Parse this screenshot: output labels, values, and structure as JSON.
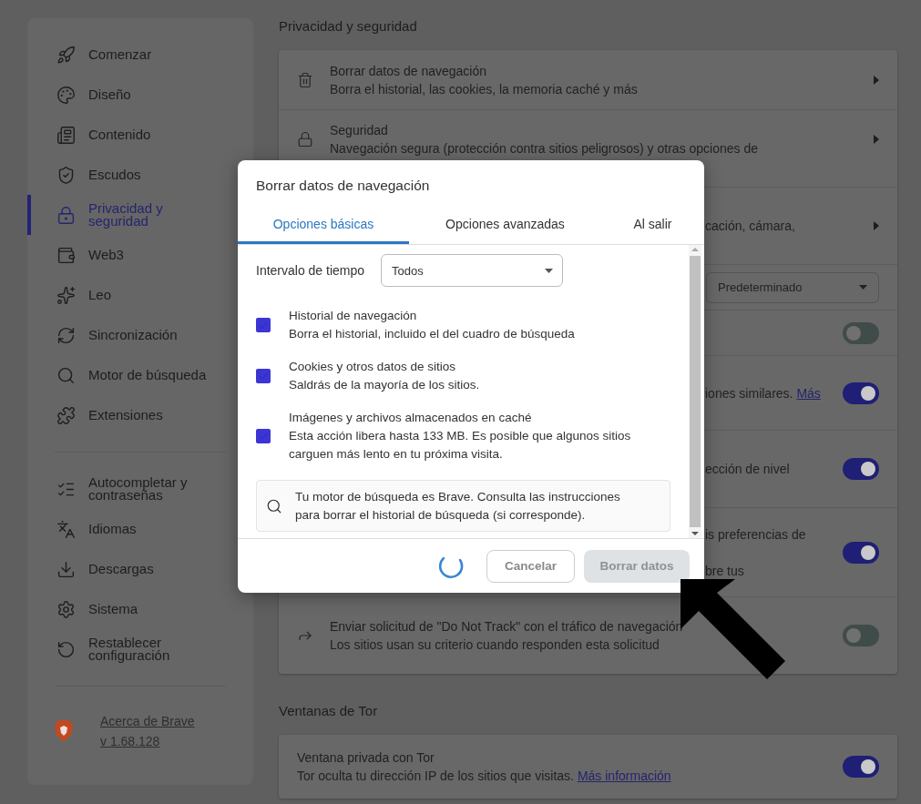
{
  "sidebar": {
    "groups": [
      {
        "items": [
          {
            "label": "Comenzar",
            "selected": false
          },
          {
            "label": "Diseño",
            "selected": false
          },
          {
            "label": "Contenido",
            "selected": false
          },
          {
            "label": "Escudos",
            "selected": false
          },
          {
            "label": "Privacidad y seguridad",
            "selected": true
          },
          {
            "label": "Web3",
            "selected": false
          },
          {
            "label": "Leo",
            "selected": false
          },
          {
            "label": "Sincronización",
            "selected": false
          },
          {
            "label": "Motor de búsqueda",
            "selected": false
          },
          {
            "label": "Extensiones",
            "selected": false
          }
        ]
      },
      {
        "items": [
          {
            "label": "Autocompletar y contraseñas",
            "selected": false
          },
          {
            "label": "Idiomas",
            "selected": false
          },
          {
            "label": "Descargas",
            "selected": false
          },
          {
            "label": "Sistema",
            "selected": false
          },
          {
            "label": "Restablecer configuración",
            "selected": false
          }
        ]
      }
    ],
    "about": {
      "link": "Acerca de Brave",
      "version": "v 1.68.128"
    }
  },
  "sections": [
    {
      "title": "Privacidad y seguridad",
      "rows": [
        {
          "kind": "arrow",
          "title": "Borrar datos de navegación",
          "description": "Borra el historial, las cookies, la memoria caché y más"
        },
        {
          "kind": "arrow",
          "title": "Seguridad",
          "description": "Navegación segura (protección contra sitios peligrosos) y otras opciones de"
        },
        {
          "kind": "arrow",
          "lines": [
            "cación, cámara,"
          ]
        },
        {
          "kind": "select",
          "value": "Predeterminado"
        },
        {
          "kind": "toggle",
          "on": false
        },
        {
          "kind": "toggle",
          "lines": [
            "iones similares."
          ],
          "link": "Más",
          "on": true
        },
        {
          "kind": "toggle",
          "lines": [
            "ección de nivel"
          ],
          "on": true
        },
        {
          "kind": "toggle",
          "lines": [
            "is preferencias de",
            "bre tus"
          ],
          "on": true
        },
        {
          "kind": "toggle",
          "title": "Enviar solicitud de \"Do Not Track\" con el tráfico de navegación",
          "description": "Los sitios usan su criterio cuando responden esta solicitud",
          "on": false
        }
      ]
    },
    {
      "title": "Ventanas de Tor",
      "rows": [
        {
          "kind": "toggle",
          "title": "Ventana privada con Tor",
          "description": "Tor oculta tu dirección IP de los sitios que visitas.",
          "link": "Más información",
          "on": true
        }
      ]
    }
  ],
  "dialog": {
    "title": "Borrar datos de navegación",
    "tabs": [
      {
        "label": "Opciones básicas",
        "selected": true
      },
      {
        "label": "Opciones avanzadas",
        "selected": false
      },
      {
        "label": "Al salir",
        "selected": false
      }
    ],
    "time_range": {
      "label": "Intervalo de tiempo",
      "value": "Todos"
    },
    "options": [
      {
        "title": "Historial de navegación",
        "description": "Borra el historial, incluido el del cuadro de búsqueda",
        "checked": true
      },
      {
        "title": "Cookies y otros datos de sitios",
        "description": "Saldrás de la mayoría de los sitios.",
        "checked": true
      },
      {
        "title": "Imágenes y archivos almacenados en caché",
        "description": "Esta acción libera hasta 133 MB. Es posible que algunos sitios carguen más lento en tu próxima visita.",
        "checked": true
      }
    ],
    "notice": "Tu motor de búsqueda es Brave. Consulta las instrucciones para borrar el historial de búsqueda (si corresponde).",
    "loading": true,
    "buttons": {
      "cancel": "Cancelar",
      "confirm": {
        "label": "Borrar datos",
        "disabled": true
      }
    }
  }
}
